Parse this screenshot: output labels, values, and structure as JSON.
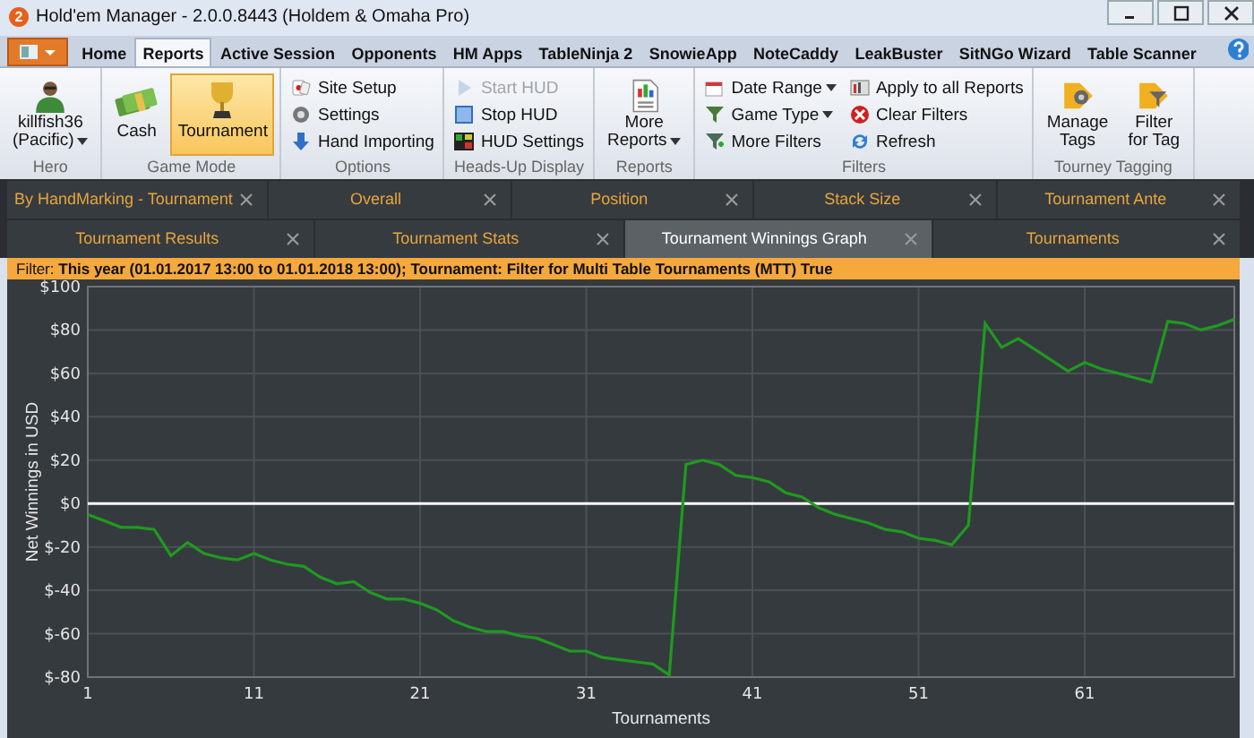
{
  "window": {
    "badge": "2",
    "title": "Hold'em Manager - 2.0.0.8443 (Holdem & Omaha Pro)"
  },
  "ribbon_tabs": [
    {
      "label": "Home",
      "selected": false
    },
    {
      "label": "Reports",
      "selected": true
    },
    {
      "label": "Active Session",
      "selected": false
    },
    {
      "label": "Opponents",
      "selected": false
    },
    {
      "label": "HM Apps",
      "selected": false
    },
    {
      "label": "TableNinja 2",
      "selected": false
    },
    {
      "label": "SnowieApp",
      "selected": false
    },
    {
      "label": "NoteCaddy",
      "selected": false
    },
    {
      "label": "LeakBuster",
      "selected": false
    },
    {
      "label": "SitNGo Wizard",
      "selected": false
    },
    {
      "label": "Table Scanner",
      "selected": false
    }
  ],
  "ribbon_groups": [
    {
      "label": "Hero",
      "columns": [
        [
          {
            "kind": "large",
            "label": "killfish36\n(Pacific)",
            "dropdown": true,
            "selected": false,
            "disabled": false
          }
        ]
      ]
    },
    {
      "label": "Game Mode",
      "columns": [
        [
          {
            "kind": "large",
            "label": "Cash",
            "dropdown": false,
            "selected": false,
            "disabled": false
          }
        ],
        [
          {
            "kind": "large",
            "label": "Tournament",
            "dropdown": false,
            "selected": true,
            "disabled": false
          }
        ]
      ]
    },
    {
      "label": "Options",
      "columns": [
        [
          {
            "kind": "small",
            "label": "Site Setup",
            "dropdown": false,
            "selected": false,
            "disabled": false
          },
          {
            "kind": "small",
            "label": "Settings",
            "dropdown": false,
            "selected": false,
            "disabled": false
          },
          {
            "kind": "small",
            "label": "Hand Importing",
            "dropdown": false,
            "selected": false,
            "disabled": false
          }
        ]
      ]
    },
    {
      "label": "Heads-Up Display",
      "columns": [
        [
          {
            "kind": "small",
            "label": "Start HUD",
            "dropdown": false,
            "selected": false,
            "disabled": true
          },
          {
            "kind": "small",
            "label": "Stop HUD",
            "dropdown": false,
            "selected": false,
            "disabled": false
          },
          {
            "kind": "small",
            "label": "HUD Settings",
            "dropdown": false,
            "selected": false,
            "disabled": false
          }
        ]
      ]
    },
    {
      "label": "Reports",
      "columns": [
        [
          {
            "kind": "large",
            "label": "More\nReports",
            "dropdown": true,
            "selected": false,
            "disabled": false
          }
        ]
      ]
    },
    {
      "label": "Filters",
      "columns": [
        [
          {
            "kind": "small",
            "label": "Date Range",
            "dropdown": true,
            "selected": false,
            "disabled": false
          },
          {
            "kind": "small",
            "label": "Game Type",
            "dropdown": true,
            "selected": false,
            "disabled": false
          },
          {
            "kind": "small",
            "label": "More Filters",
            "dropdown": false,
            "selected": false,
            "disabled": false
          }
        ],
        [
          {
            "kind": "small",
            "label": "Apply to all Reports",
            "dropdown": false,
            "selected": false,
            "disabled": false
          },
          {
            "kind": "small",
            "label": "Clear Filters",
            "dropdown": false,
            "selected": false,
            "disabled": false
          },
          {
            "kind": "small",
            "label": "Refresh",
            "dropdown": false,
            "selected": false,
            "disabled": false
          }
        ]
      ]
    },
    {
      "label": "Tourney Tagging",
      "columns": [
        [
          {
            "kind": "large",
            "label": "Manage\nTags",
            "dropdown": false,
            "selected": false,
            "disabled": false
          }
        ],
        [
          {
            "kind": "large",
            "label": "Filter\nfor Tag",
            "dropdown": false,
            "selected": false,
            "disabled": false
          }
        ]
      ]
    }
  ],
  "report_tabs": [
    [
      {
        "label": "By HandMarking - Tournament",
        "selected": false
      },
      {
        "label": "Overall",
        "selected": false
      },
      {
        "label": "Position",
        "selected": false
      },
      {
        "label": "Stack Size",
        "selected": false
      },
      {
        "label": "Tournament Ante",
        "selected": false
      }
    ],
    [
      {
        "label": "Tournament Results",
        "selected": false
      },
      {
        "label": "Tournament Stats",
        "selected": false
      },
      {
        "label": "Tournament Winnings Graph",
        "selected": true
      },
      {
        "label": "Tournaments",
        "selected": false
      }
    ]
  ],
  "filter_bar": "Filter: **This year (01.01.2017 13:00 to 01.01.2018 13:00); Tournament: Filter for Multi Table Tournaments (MTT) True**",
  "chart": {
    "chart_data": {
      "type": "line",
      "grid": true,
      "xlabel": "Tournaments",
      "ylabel": "Net Winnings in USD",
      "x": [
        1,
        2,
        3,
        4,
        5,
        6,
        7,
        8,
        9,
        10,
        11,
        12,
        13,
        14,
        15,
        16,
        17,
        18,
        19,
        20,
        21,
        22,
        23,
        24,
        25,
        26,
        27,
        28,
        29,
        30,
        31,
        32,
        33,
        34,
        35,
        36,
        37,
        38,
        39,
        40,
        41,
        42,
        43,
        44,
        45,
        46,
        47,
        48,
        49,
        50,
        51,
        52,
        53,
        54,
        55,
        56,
        57,
        58,
        59,
        60,
        61,
        62,
        63,
        64,
        65,
        66,
        67,
        68,
        69,
        70
      ],
      "series": [
        {
          "color": "#1f9a1f",
          "values": [
            -5,
            -8,
            -11,
            -11,
            -12,
            -24,
            -18,
            -23,
            -25,
            -26,
            -23,
            -26,
            -28,
            -29,
            -34,
            -37,
            -36,
            -41,
            -44,
            -44,
            -46,
            -49,
            -54,
            -57,
            -59,
            -59,
            -61,
            -62,
            -65,
            -68,
            -68,
            -71,
            -72,
            -73,
            -74,
            -79,
            18,
            20,
            18,
            13,
            12,
            10,
            5,
            3,
            -2,
            -5,
            -7,
            -9,
            -12,
            -13,
            -16,
            -17,
            -19,
            -10,
            83,
            72,
            76,
            71,
            66,
            61,
            65,
            62,
            60,
            58,
            56,
            84,
            83,
            80,
            82,
            85
          ]
        }
      ],
      "xlim": [
        1,
        70
      ],
      "ylim": [
        -80,
        100
      ],
      "xticks": [
        1,
        11,
        21,
        31,
        41,
        51,
        61
      ],
      "yticks": [
        {
          "value": -80,
          "label": "$-80"
        },
        {
          "value": -60,
          "label": "$-60"
        },
        {
          "value": -40,
          "label": "$-40"
        },
        {
          "value": -20,
          "label": "$-20"
        },
        {
          "value": 0,
          "label": "$0"
        },
        {
          "value": 20,
          "label": "$20"
        },
        {
          "value": 40,
          "label": "$40"
        },
        {
          "value": 60,
          "label": "$60"
        },
        {
          "value": 80,
          "label": "$80"
        },
        {
          "value": 100,
          "label": "$100"
        }
      ]
    }
  }
}
